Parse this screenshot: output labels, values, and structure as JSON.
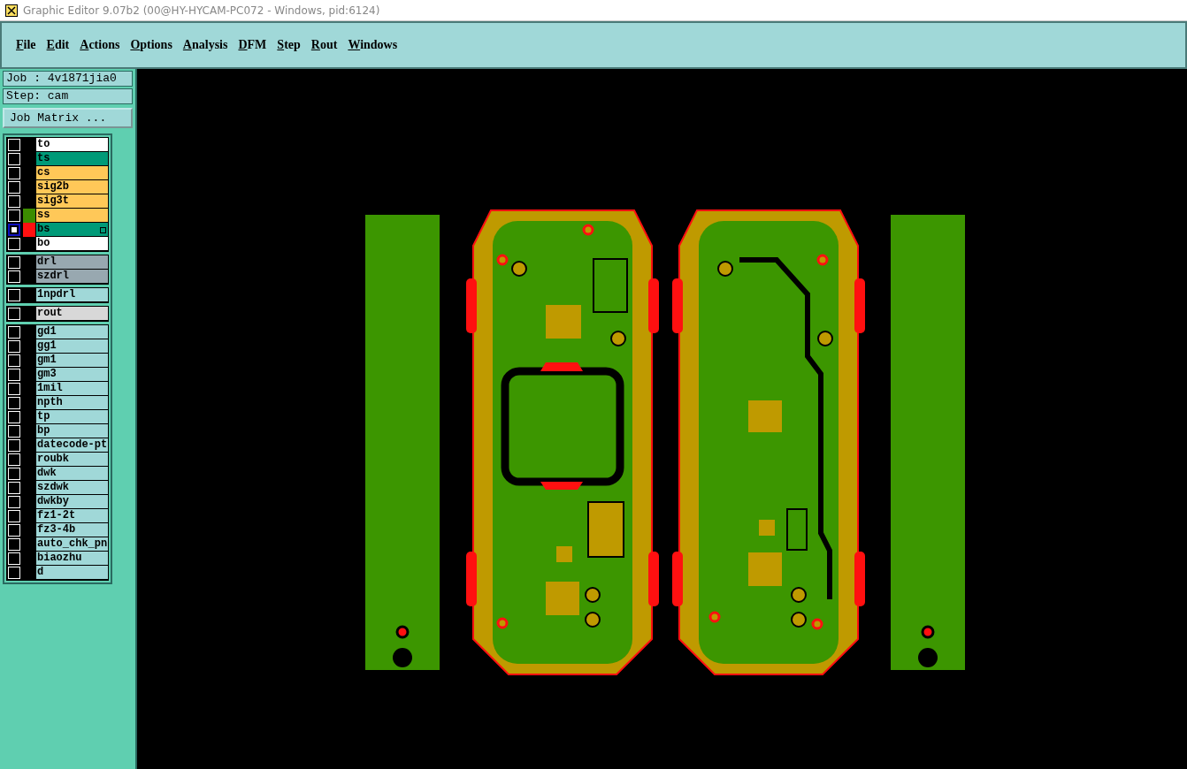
{
  "window": {
    "title": "Graphic Editor 9.07b2 (00@HY-HYCAM-PC072 - Windows, pid:6124)"
  },
  "menu": [
    "File",
    "Edit",
    "Actions",
    "Options",
    "Analysis",
    "DFM",
    "Step",
    "Rout",
    "Windows"
  ],
  "job": {
    "job_label": "Job : 4v1871jia0",
    "step_label": "Step: cam",
    "matrix_button": "Job Matrix ..."
  },
  "layer_groups": [
    {
      "layers": [
        {
          "name": "to",
          "color": "#ffffff",
          "selected": false
        },
        {
          "name": "ts",
          "color": "#009a78",
          "selected": false
        },
        {
          "name": "cs",
          "color": "#ffc858",
          "selected": false
        },
        {
          "name": "sig2b",
          "color": "#ffc858",
          "selected": false
        },
        {
          "name": "sig3t",
          "color": "#ffc858",
          "selected": false
        },
        {
          "name": "ss",
          "color": "#ffc858",
          "selected": false,
          "swatch": {
            "color": "#3c8c00"
          }
        },
        {
          "name": "bs",
          "color": "#009a78",
          "selected": true,
          "swatch": {
            "color": "#ff1010"
          },
          "work_layer": true
        },
        {
          "name": "bo",
          "color": "#ffffff",
          "selected": false
        }
      ]
    },
    {
      "layers": [
        {
          "name": "drl",
          "color": "#98a8b0",
          "selected": false
        },
        {
          "name": "szdrl",
          "color": "#98a8b0",
          "selected": false
        }
      ]
    },
    {
      "layers": [
        {
          "name": "1npdrl",
          "color": "#a0d8d8",
          "selected": false
        }
      ]
    },
    {
      "layers": [
        {
          "name": "rout",
          "color": "#d8d8d8",
          "selected": false
        }
      ]
    },
    {
      "layers": [
        {
          "name": "gd1",
          "color": "#a0d8d8",
          "selected": false
        },
        {
          "name": "gg1",
          "color": "#a0d8d8",
          "selected": false
        },
        {
          "name": "gm1",
          "color": "#a0d8d8",
          "selected": false
        },
        {
          "name": "gm3",
          "color": "#a0d8d8",
          "selected": false
        },
        {
          "name": "1mil",
          "color": "#a0d8d8",
          "selected": false
        },
        {
          "name": "npth",
          "color": "#a0d8d8",
          "selected": false
        },
        {
          "name": "tp",
          "color": "#a0d8d8",
          "selected": false
        },
        {
          "name": "bp",
          "color": "#a0d8d8",
          "selected": false
        },
        {
          "name": "datecode-pt",
          "color": "#a0d8d8",
          "selected": false
        },
        {
          "name": "roubk",
          "color": "#a0d8d8",
          "selected": false
        },
        {
          "name": "dwk",
          "color": "#a0d8d8",
          "selected": false
        },
        {
          "name": "szdwk",
          "color": "#a0d8d8",
          "selected": false
        },
        {
          "name": "dwkby",
          "color": "#a0d8d8",
          "selected": false
        },
        {
          "name": "fz1-2t",
          "color": "#a0d8d8",
          "selected": false
        },
        {
          "name": "fz3-4b",
          "color": "#a0d8d8",
          "selected": false
        },
        {
          "name": "auto_chk_pn",
          "color": "#a0d8d8",
          "selected": false
        },
        {
          "name": "biaozhu",
          "color": "#a0d8d8",
          "selected": false
        },
        {
          "name": "d",
          "color": "#a0d8d8",
          "selected": false
        }
      ]
    }
  ]
}
